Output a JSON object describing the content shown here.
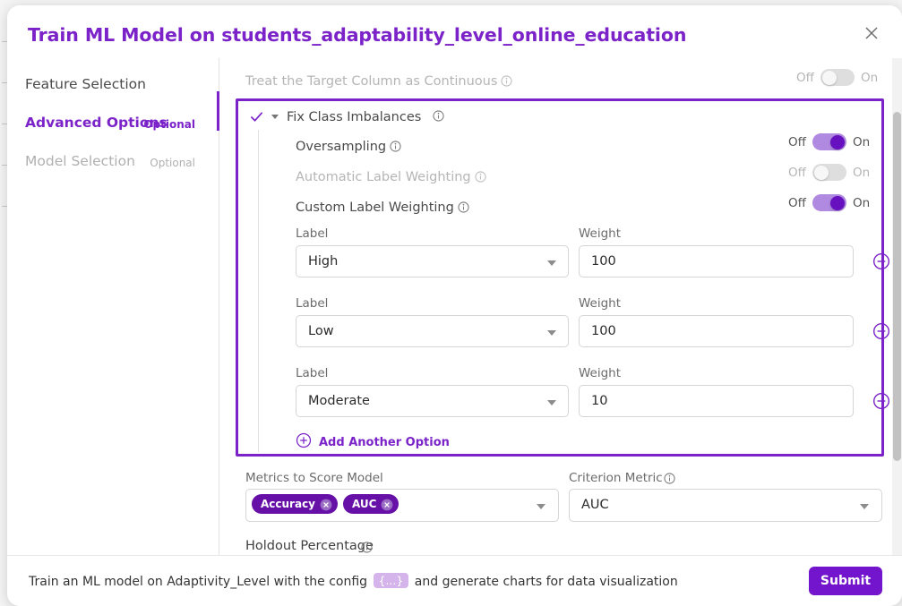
{
  "header": {
    "title": "Train ML Model on students_adaptability_level_online_education",
    "close_label": "×"
  },
  "sidebar": {
    "items": [
      {
        "label": "Feature Selection",
        "badge": ""
      },
      {
        "label": "Advanced Options",
        "badge": "Optional"
      },
      {
        "label": "Model Selection",
        "badge": "Optional"
      }
    ]
  },
  "main": {
    "target_continuous": {
      "label": "Treat the Target Column as Continuous",
      "off": "Off",
      "on": "On",
      "state": "off"
    },
    "group": {
      "title": "Fix Class Imbalances",
      "toggles": [
        {
          "label": "Oversampling",
          "off": "Off",
          "on": "On",
          "state": "on"
        },
        {
          "label": "Automatic Label Weighting",
          "off": "Off",
          "on": "On",
          "state": "off"
        },
        {
          "label": "Custom Label Weighting",
          "off": "Off",
          "on": "On",
          "state": "on"
        }
      ],
      "label_header": "Label",
      "weight_header": "Weight",
      "rows": [
        {
          "label": "High",
          "weight": "100"
        },
        {
          "label": "Low",
          "weight": "100"
        },
        {
          "label": "Moderate",
          "weight": "10"
        }
      ],
      "add_option": "Add Another Option"
    },
    "metrics": {
      "metrics_label": "Metrics to Score Model",
      "chips": [
        "Accuracy",
        "AUC"
      ],
      "criterion_label": "Criterion Metric",
      "criterion_value": "AUC",
      "holdout_label": "Holdout Percentage"
    }
  },
  "footer": {
    "text_before": "Train an ML model on Adaptivity_Level with the config",
    "config_badge": "{...}",
    "text_after": "and generate charts for data visualization",
    "submit": "Submit"
  },
  "colors": {
    "accent": "#7b23c9",
    "submit": "#7215cc",
    "chip": "#6610a8",
    "toggle_on_track": "#b089e0",
    "toggle_on_knob": "#6610c0",
    "badge": "#d4b4ea"
  }
}
